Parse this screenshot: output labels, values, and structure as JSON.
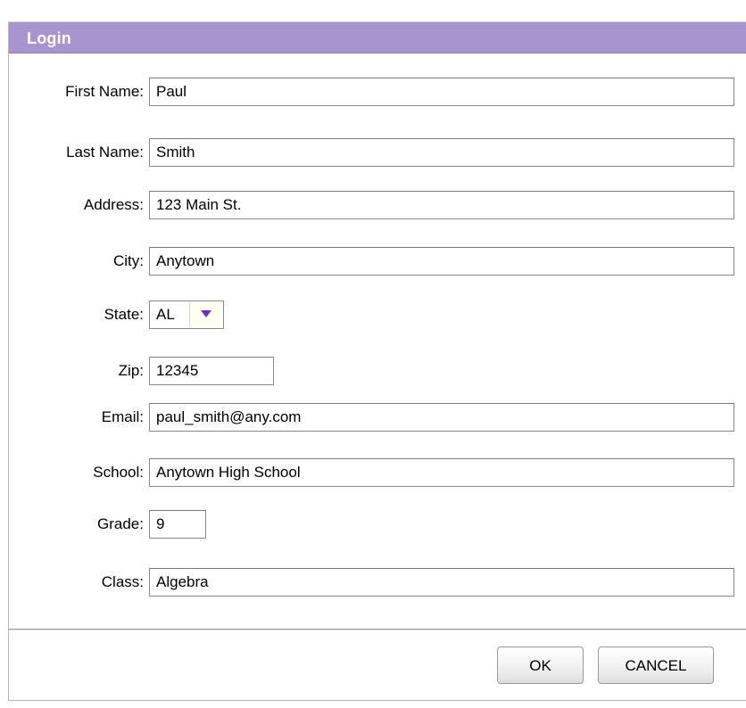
{
  "dialog": {
    "title": "Login"
  },
  "form": {
    "first_name": {
      "label": "First Name:",
      "value": "Paul"
    },
    "last_name": {
      "label": "Last Name:",
      "value": "Smith"
    },
    "address": {
      "label": "Address:",
      "value": "123 Main St."
    },
    "city": {
      "label": "City:",
      "value": "Anytown"
    },
    "state": {
      "label": "State:",
      "value": "AL"
    },
    "zip": {
      "label": "Zip:",
      "value": "12345"
    },
    "email": {
      "label": "Email:",
      "value": "paul_smith@any.com"
    },
    "school": {
      "label": "School:",
      "value": "Anytown High School"
    },
    "grade": {
      "label": "Grade:",
      "value": "9"
    },
    "class": {
      "label": "Class:",
      "value": "Algebra"
    }
  },
  "buttons": {
    "ok": "OK",
    "cancel": "CANCEL"
  },
  "colors": {
    "titlebar": "#a895cf",
    "dropdown_arrow": "#6b2fb8",
    "dropdown_bg": "#fffff2"
  },
  "icons": {
    "state_dropdown": "chevron-down-icon"
  }
}
